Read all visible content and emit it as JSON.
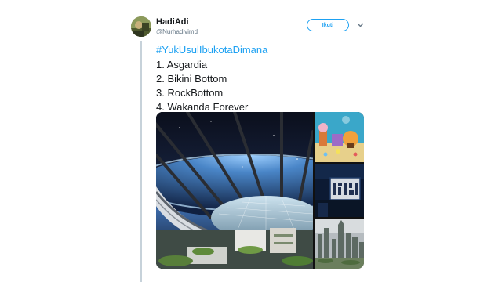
{
  "tweet": {
    "display_name": "HadiAdi",
    "handle": "@Nurhadivimd",
    "follow_label": "Ikuti",
    "hashtag": "#YukUsulIbukotaDimana",
    "options": [
      "1. Asgardia",
      "2. Bikini Bottom",
      "3. RockBottom",
      "4. Wakanda Forever"
    ],
    "media": {
      "main": "space-station-habitat-image",
      "side": [
        "bikini-bottom-cartoon-image",
        "rock-bottom-sign-image",
        "wakanda-city-image"
      ]
    }
  },
  "colors": {
    "link": "#1da1f2",
    "text": "#14171a",
    "muted": "#657786",
    "thread": "#c7d2da"
  },
  "icons": [
    "avatar",
    "chevron-down-icon"
  ]
}
